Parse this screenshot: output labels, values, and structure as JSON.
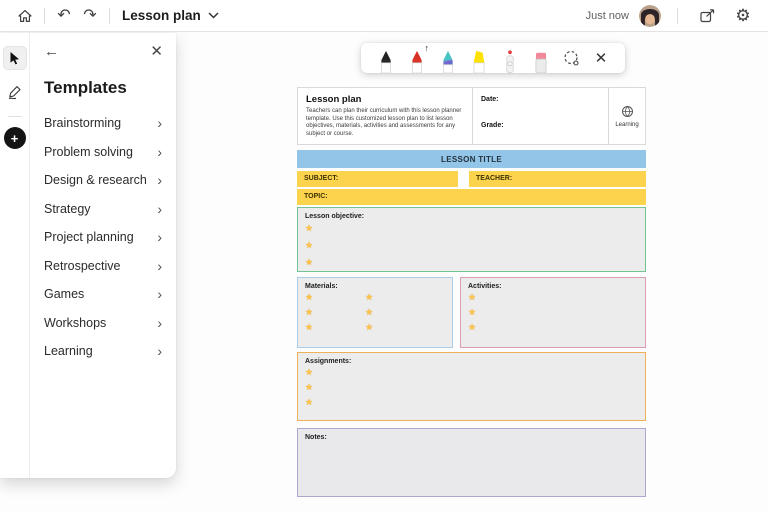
{
  "glyphs": {
    "undo_glyph": "↶",
    "redo_glyph": "↷",
    "gear_glyph": "⚙",
    "close_glyph": "✕",
    "back_glyph": "←",
    "chevron_glyph": "›",
    "plus_glyph": "+",
    "star_glyph": "★",
    "up_arrow_glyph": "↑"
  },
  "topbar": {
    "title": "Lesson plan",
    "status": "Just now"
  },
  "templates_panel": {
    "title": "Templates",
    "items": [
      "Brainstorming",
      "Problem solving",
      "Design & research",
      "Strategy",
      "Project planning",
      "Retrospective",
      "Games",
      "Workshops",
      "Learning"
    ]
  },
  "pen_toolbar": {
    "tools": [
      "black-pen",
      "red-pen",
      "galaxy-pen",
      "highlighter",
      "laser-pointer",
      "eraser",
      "lasso-select",
      "close"
    ],
    "active_tool": "red-pen"
  },
  "template": {
    "header": {
      "title": "Lesson plan",
      "description": "Teachers can plan their curriculum with this lesson planner template. Use this customized lesson plan to list lesson objectives, materials, activities and assessments for any subject or course.",
      "date_label": "Date:",
      "grade_label": "Grade:",
      "category_label": "Learning"
    },
    "lesson_title_label": "LESSON TITLE",
    "subject_label": "SUBJECT:",
    "teacher_label": "TEACHER:",
    "topic_label": "TOPIC:",
    "sections": {
      "objective": {
        "label": "Lesson objective:",
        "stars": 3
      },
      "materials": {
        "label": "Materials:",
        "stars_col1": 3,
        "stars_col2": 3
      },
      "activities": {
        "label": "Activities:",
        "stars": 3
      },
      "assignments": {
        "label": "Assignments:",
        "stars": 3
      },
      "notes": {
        "label": "Notes:"
      }
    },
    "colors": {
      "lesson_title_bar": "#92C5E8",
      "field_yellow": "#FBD34D",
      "objective_border": "#74C493",
      "materials_border": "#A9CCE9",
      "activities_border": "#DA9CB8",
      "assignments_border": "#ECB159",
      "notes_border": "#ABA7CF",
      "box_background": "#ECECEC",
      "star": "#FFC24A"
    }
  }
}
